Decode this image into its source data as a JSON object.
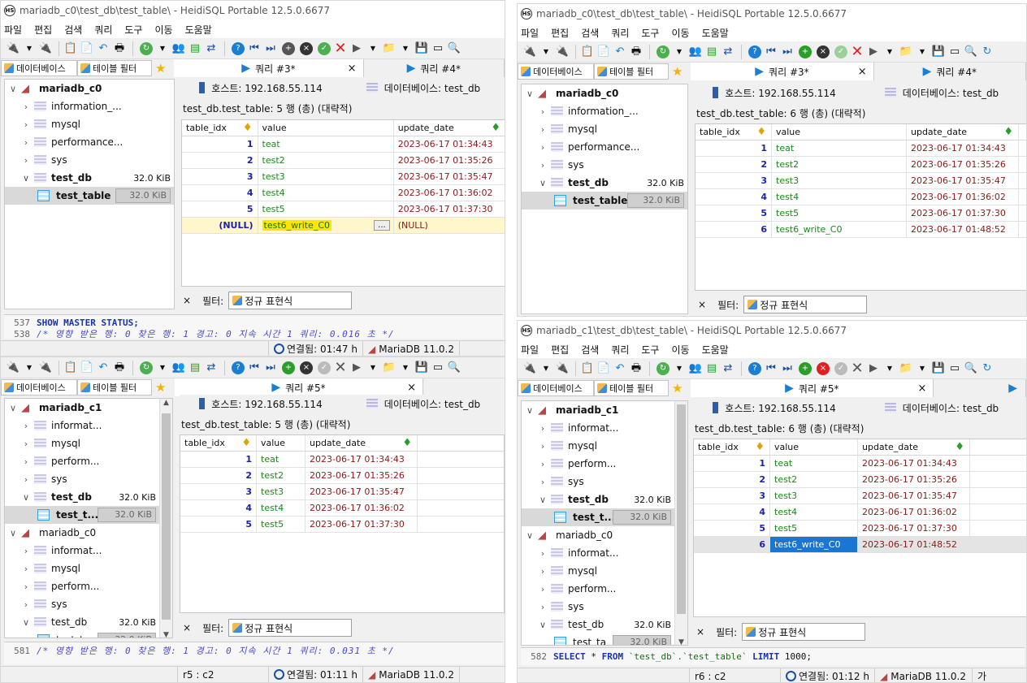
{
  "app": {
    "titles": {
      "tl": "mariadb_c0\\test_db\\test_table\\ - HeidiSQL Portable 12.5.0.6677",
      "tr": "mariadb_c0\\test_db\\test_table\\ - HeidiSQL Portable 12.5.0.6677",
      "br": "mariadb_c1\\test_db\\test_table\\ - HeidiSQL Portable 12.5.0.6677"
    },
    "menu": [
      "파일",
      "편집",
      "검색",
      "쿼리",
      "도구",
      "이동",
      "도움말"
    ],
    "icon_text": "HS"
  },
  "tabs": {
    "left_db": "데이터베이스",
    "left_filter": "테이블 필터",
    "q3": "쿼리 #3*",
    "q4": "쿼리 #4*",
    "q5": "쿼리 #5*",
    "close": "×"
  },
  "host": {
    "host_label": "호스트: 192.168.55.114",
    "db_label": "데이터베이스: test_db"
  },
  "tree_c0": {
    "server": "mariadb_c0",
    "dbs": [
      "information_...",
      "mysql",
      "performance...",
      "sys"
    ],
    "test_db": "test_db",
    "test_db_size": "32.0 KiB",
    "table": "test_table",
    "table_size": "32.0 KiB"
  },
  "tree_c1": {
    "server": "mariadb_c1",
    "dbs": [
      "informat...",
      "mysql",
      "perform...",
      "sys"
    ],
    "test_db": "test_db",
    "test_db_size": "32.0 KiB",
    "table": "test_t...",
    "table_size": "32.0 KiB",
    "server2": "mariadb_c0",
    "dbs2": [
      "informat...",
      "mysql",
      "perform...",
      "sys"
    ],
    "test_db2": "test_db",
    "test_db2_size": "32.0 KiB",
    "table2": "test_ta",
    "table2_size": "32.0 KiB"
  },
  "grid": {
    "info5": "test_db.test_table: 5 행 (총) (대략적)",
    "info6": "test_db.test_table: 6 행 (총) (대략적)",
    "headers": [
      "table_idx",
      "value",
      "update_date"
    ],
    "rows": [
      [
        "1",
        "teat",
        "2023-06-17 01:34:43"
      ],
      [
        "2",
        "test2",
        "2023-06-17 01:35:26"
      ],
      [
        "3",
        "test3",
        "2023-06-17 01:35:47"
      ],
      [
        "4",
        "test4",
        "2023-06-17 01:36:02"
      ],
      [
        "5",
        "test5",
        "2023-06-17 01:37:30"
      ]
    ],
    "row6": [
      "6",
      "test6_write_C0",
      "2023-06-17 01:48:52"
    ],
    "new_row": [
      "(NULL)",
      "test6_write_C0",
      "...",
      "(NULL)"
    ]
  },
  "filter": {
    "label": "필터:",
    "placeholder": "정규 표현식",
    "x": "×"
  },
  "sql": {
    "tl": [
      {
        "ln": "537",
        "code": "SHOW MASTER STATUS;"
      },
      {
        "ln": "538",
        "code": "/* 영향 받은 행: 0  찾은 행: 1  경고: 0  지속 시간 1 쿼리: 0.016 초 */"
      }
    ],
    "bl": [
      {
        "ln": "581",
        "code": "/* 영향 받은 행: 0  찾은 행: 1  경고: 0  지속 시간 1 쿼리: 0.031 초 */"
      }
    ],
    "br": {
      "ln": "582",
      "kw1": "SELECT",
      "star": " * ",
      "kw2": "FROM",
      "tbl": " `test_db`.`test_table` ",
      "kw3": "LIMIT",
      "num": " 1000;"
    }
  },
  "status": {
    "tl_conn": "연결됨: 01:47 h",
    "tl_db": "MariaDB 11.0.2",
    "bl_pos": "r5 : c2",
    "bl_conn": "연결됨: 01:11 h",
    "bl_db": "MariaDB 11.0.2",
    "br_pos": "r6 : c2",
    "br_conn": "연결됨: 01:12 h",
    "br_db": "MariaDB 11.0.2",
    "br_extra": "가"
  },
  "colors": {
    "accent": "#1a7fd4",
    "selection": "#1976d2",
    "null_edit": "#fff6cc"
  }
}
